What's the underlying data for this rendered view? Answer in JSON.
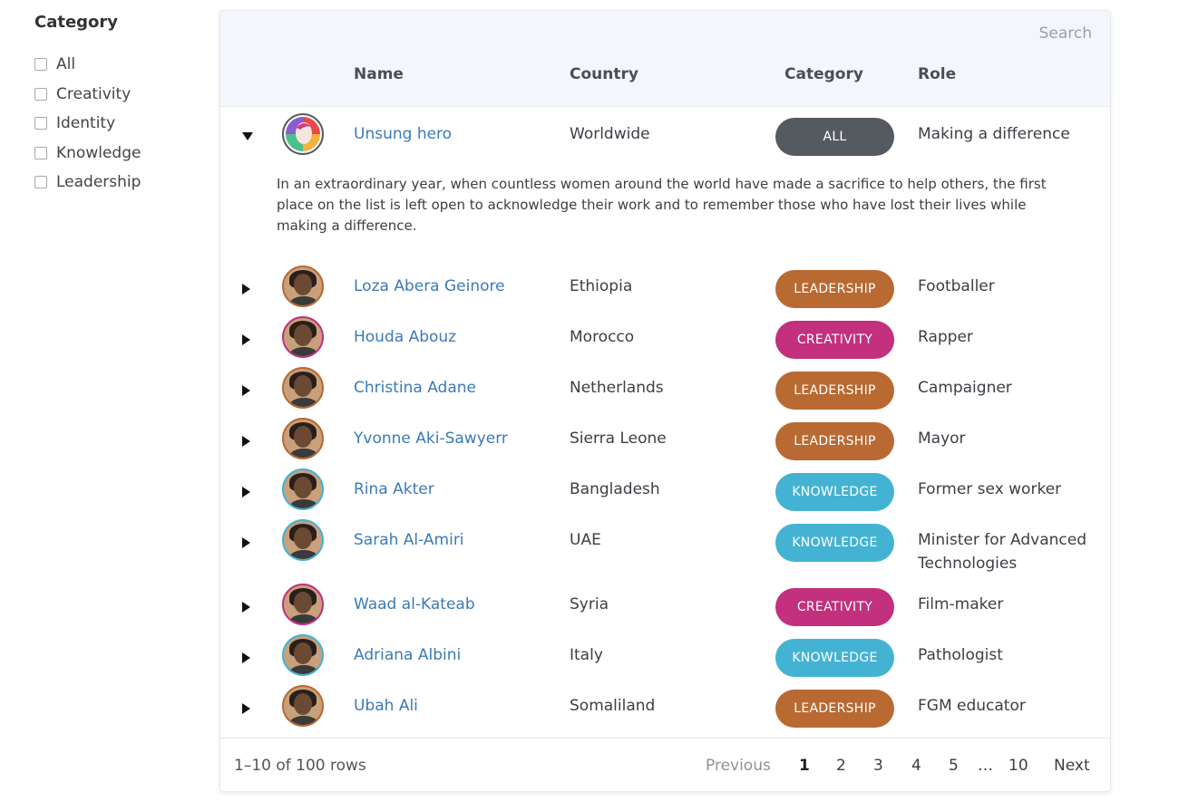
{
  "sidebar": {
    "title": "Category",
    "filters": [
      "All",
      "Creativity",
      "Identity",
      "Knowledge",
      "Leadership"
    ]
  },
  "search": {
    "placeholder": "Search"
  },
  "columns": {
    "name": "Name",
    "country": "Country",
    "category": "Category",
    "role": "Role"
  },
  "category_colors": {
    "ALL": "#555a60",
    "LEADERSHIP": "#b86a32",
    "CREATIVITY": "#c2307e",
    "KNOWLEDGE": "#44b3d3"
  },
  "rows": [
    {
      "name": "Unsung hero",
      "country": "Worldwide",
      "category": "ALL",
      "role": "Making a difference",
      "expanded": true,
      "description": "In an extraordinary year, when countless women around the world have made a sacrifice to help others, the first place on the list is left open to acknowledge their work and to remember those who have lost their lives while making a difference."
    },
    {
      "name": "Loza Abera Geinore",
      "country": "Ethiopia",
      "category": "LEADERSHIP",
      "role": "Footballer"
    },
    {
      "name": "Houda Abouz",
      "country": "Morocco",
      "category": "CREATIVITY",
      "role": "Rapper"
    },
    {
      "name": "Christina Adane",
      "country": "Netherlands",
      "category": "LEADERSHIP",
      "role": "Campaigner"
    },
    {
      "name": "Yvonne Aki-Sawyerr",
      "country": "Sierra Leone",
      "category": "LEADERSHIP",
      "role": "Mayor"
    },
    {
      "name": "Rina Akter",
      "country": "Bangladesh",
      "category": "KNOWLEDGE",
      "role": "Former sex worker"
    },
    {
      "name": "Sarah Al-Amiri",
      "country": "UAE",
      "category": "KNOWLEDGE",
      "role": "Minister for Advanced Technologies"
    },
    {
      "name": "Waad al-Kateab",
      "country": "Syria",
      "category": "CREATIVITY",
      "role": "Film-maker"
    },
    {
      "name": "Adriana Albini",
      "country": "Italy",
      "category": "KNOWLEDGE",
      "role": "Pathologist"
    },
    {
      "name": "Ubah Ali",
      "country": "Somaliland",
      "category": "LEADERSHIP",
      "role": "FGM educator"
    }
  ],
  "footer": {
    "rows_info": "1–10 of 100 rows",
    "previous": "Previous",
    "pages": [
      "1",
      "2",
      "3",
      "4",
      "5",
      "…",
      "10"
    ],
    "current_page": "1",
    "next": "Next"
  }
}
